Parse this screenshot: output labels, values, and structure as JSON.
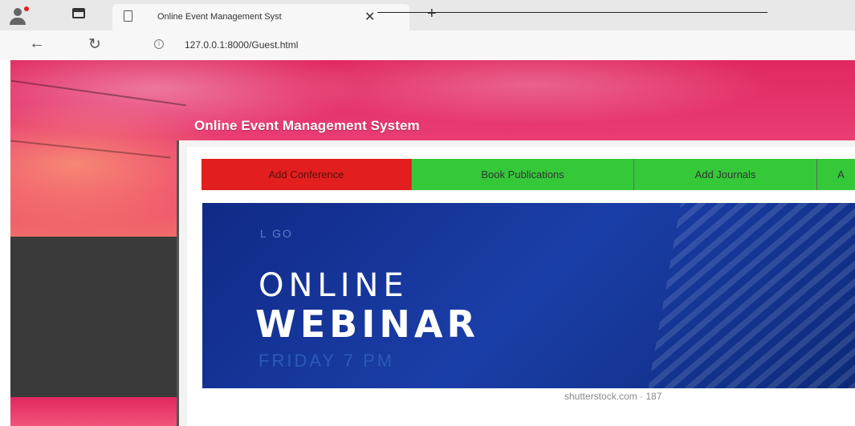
{
  "browser": {
    "tab_title": "Online Event Management Syst",
    "tab_close": "✕",
    "new_tab": "+",
    "url": "127.0.0.1:8000/Guest.html",
    "back": "←",
    "reload": "↻",
    "info": "i"
  },
  "header": {
    "title": "Online Event Management System"
  },
  "nav": {
    "items": [
      {
        "label": "Add Conference"
      },
      {
        "label": "Book Publications"
      },
      {
        "label": "Add Journals"
      },
      {
        "label": "A"
      }
    ]
  },
  "banner": {
    "logo": "L GO",
    "online": "ONLINE",
    "webinar": "WEBINAR",
    "time": "FRIDAY 7 PM",
    "watermark": "shutterstock.com · 187"
  },
  "colors": {
    "banner_pink": "#e0285f",
    "nav_red": "#e31e1e",
    "nav_green": "#35c93a",
    "webinar_blue": "#102a86",
    "sidebar_dark": "#3a3a3a"
  }
}
